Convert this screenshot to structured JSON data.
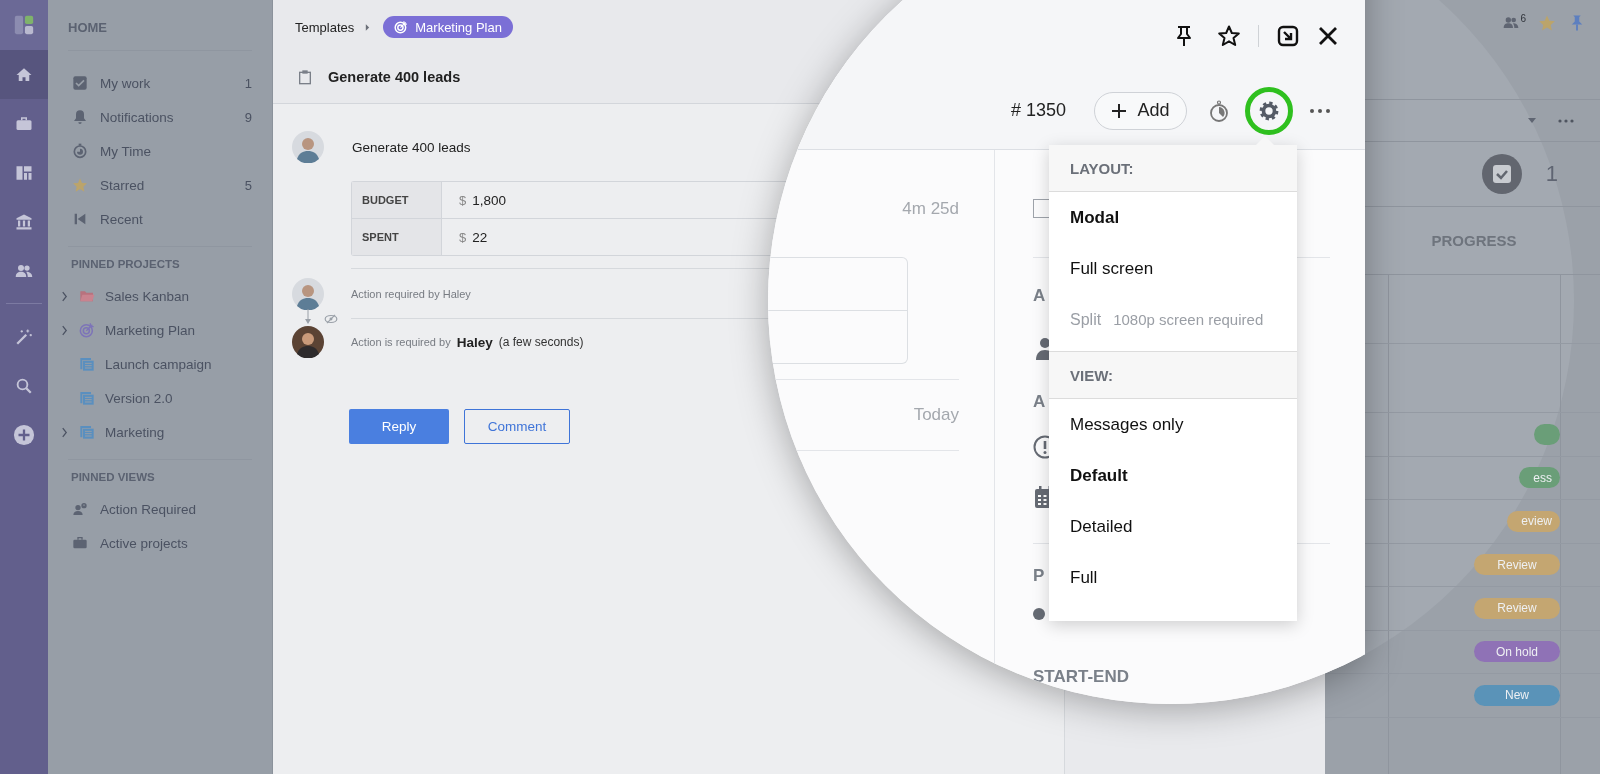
{
  "rail": {
    "primary_items": [
      {
        "kind": "home",
        "selected": true
      },
      {
        "kind": "briefcase",
        "selected": false
      },
      {
        "kind": "board",
        "selected": false
      },
      {
        "kind": "bank",
        "selected": false
      },
      {
        "kind": "people",
        "selected": false
      }
    ],
    "tool_items": [
      {
        "kind": "wand",
        "selected": false
      },
      {
        "kind": "search",
        "selected": false
      },
      {
        "kind": "plus",
        "selected": false
      }
    ]
  },
  "sidebar": {
    "home_title": "HOME",
    "home_items": [
      {
        "kind": "check",
        "label": "My work",
        "count": "1"
      },
      {
        "kind": "bell",
        "label": "Notifications",
        "count": "9"
      },
      {
        "kind": "timer",
        "label": "My Time"
      },
      {
        "kind": "star",
        "label": "Starred",
        "count": "5"
      },
      {
        "kind": "recent",
        "label": "Recent"
      }
    ],
    "pinned_projects_title": "PINNED PROJECTS",
    "pinned_projects": [
      {
        "kind": "folder",
        "label": "Sales Kanban",
        "expandable": true
      },
      {
        "kind": "goal",
        "label": "Marketing Plan",
        "expandable": true
      },
      {
        "kind": "list",
        "label": "Launch campaign",
        "expandable": false
      },
      {
        "kind": "list",
        "label": "Version 2.0",
        "expandable": false
      },
      {
        "kind": "list",
        "label": "Marketing",
        "expandable": true
      }
    ],
    "pinned_views_title": "PINNED VIEWS",
    "pinned_views": [
      {
        "kind": "person-alert",
        "label": "Action Required"
      },
      {
        "kind": "briefcase",
        "label": "Active projects"
      }
    ]
  },
  "modal": {
    "breadcrumb": {
      "parent": "Templates",
      "project": "Marketing Plan"
    },
    "title": "Generate 400 leads",
    "message": {
      "avatar": {
        "kind": "man"
      },
      "text": "Generate 400 leads"
    },
    "fields": [
      {
        "label": "BUDGET",
        "currency": "$",
        "value": "1,800"
      },
      {
        "label": "SPENT",
        "currency": "$",
        "value": "22"
      }
    ],
    "activity": [
      {
        "avatar": {
          "kind": "man"
        },
        "text": "Action required by Haley",
        "private": false
      },
      {
        "avatar": {
          "kind": "woman"
        },
        "prefix": "Action is required by",
        "name": "Haley",
        "time": "(a few seconds)",
        "private": true
      }
    ],
    "buttons": [
      {
        "kind": "primary",
        "label": "Reply"
      },
      {
        "kind": "secondary",
        "label": "Comment"
      }
    ]
  },
  "magnifier": {
    "task_number": "# 1350",
    "add_label": "Add",
    "settings_highlighted": true,
    "duration": "4m 25d",
    "date": "Today",
    "checked": false,
    "side_labels": [
      "A",
      "A",
      "P"
    ],
    "section_label": "START-END",
    "menu": [
      {
        "title": "LAYOUT:",
        "options": [
          {
            "label": "Modal",
            "selected": true,
            "disabled": false
          },
          {
            "label": "Full screen",
            "selected": false,
            "disabled": false
          },
          {
            "label": "Split",
            "note": "1080p screen required",
            "selected": false,
            "disabled": true
          }
        ]
      },
      {
        "title": "VIEW:",
        "options": [
          {
            "label": "Messages only",
            "selected": false,
            "disabled": false
          },
          {
            "label": "Default",
            "selected": true,
            "disabled": false
          },
          {
            "label": "Detailed",
            "selected": false,
            "disabled": false
          },
          {
            "label": "Full",
            "selected": false,
            "disabled": false
          }
        ]
      }
    ]
  },
  "board": {
    "watchers_count": "6",
    "done_count": "1",
    "column_title": "PROGRESS",
    "badges": [
      {
        "color": "#6a9e78",
        "cut": true
      },
      {
        "label": "ess",
        "color": "#6a9e78",
        "cut": true
      },
      {
        "label": "eview",
        "color": "#c4a671",
        "cut": true
      },
      {
        "label": "Review",
        "color": "#c4a671",
        "cut": false
      },
      {
        "label": "Review",
        "color": "#c4a671",
        "cut": false
      },
      {
        "label": "On hold",
        "color": "#8f72b6",
        "cut": false
      },
      {
        "label": "New",
        "color": "#5a93b8",
        "cut": false
      }
    ]
  }
}
